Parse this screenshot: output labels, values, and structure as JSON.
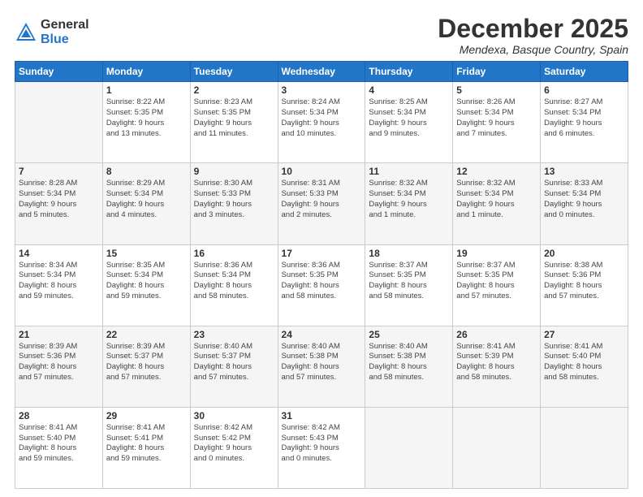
{
  "logo": {
    "general": "General",
    "blue": "Blue"
  },
  "title": "December 2025",
  "location": "Mendexa, Basque Country, Spain",
  "weekdays": [
    "Sunday",
    "Monday",
    "Tuesday",
    "Wednesday",
    "Thursday",
    "Friday",
    "Saturday"
  ],
  "weeks": [
    [
      {
        "day": "",
        "info": ""
      },
      {
        "day": "1",
        "info": "Sunrise: 8:22 AM\nSunset: 5:35 PM\nDaylight: 9 hours\nand 13 minutes."
      },
      {
        "day": "2",
        "info": "Sunrise: 8:23 AM\nSunset: 5:35 PM\nDaylight: 9 hours\nand 11 minutes."
      },
      {
        "day": "3",
        "info": "Sunrise: 8:24 AM\nSunset: 5:34 PM\nDaylight: 9 hours\nand 10 minutes."
      },
      {
        "day": "4",
        "info": "Sunrise: 8:25 AM\nSunset: 5:34 PM\nDaylight: 9 hours\nand 9 minutes."
      },
      {
        "day": "5",
        "info": "Sunrise: 8:26 AM\nSunset: 5:34 PM\nDaylight: 9 hours\nand 7 minutes."
      },
      {
        "day": "6",
        "info": "Sunrise: 8:27 AM\nSunset: 5:34 PM\nDaylight: 9 hours\nand 6 minutes."
      }
    ],
    [
      {
        "day": "7",
        "info": "Sunrise: 8:28 AM\nSunset: 5:34 PM\nDaylight: 9 hours\nand 5 minutes."
      },
      {
        "day": "8",
        "info": "Sunrise: 8:29 AM\nSunset: 5:34 PM\nDaylight: 9 hours\nand 4 minutes."
      },
      {
        "day": "9",
        "info": "Sunrise: 8:30 AM\nSunset: 5:33 PM\nDaylight: 9 hours\nand 3 minutes."
      },
      {
        "day": "10",
        "info": "Sunrise: 8:31 AM\nSunset: 5:33 PM\nDaylight: 9 hours\nand 2 minutes."
      },
      {
        "day": "11",
        "info": "Sunrise: 8:32 AM\nSunset: 5:34 PM\nDaylight: 9 hours\nand 1 minute."
      },
      {
        "day": "12",
        "info": "Sunrise: 8:32 AM\nSunset: 5:34 PM\nDaylight: 9 hours\nand 1 minute."
      },
      {
        "day": "13",
        "info": "Sunrise: 8:33 AM\nSunset: 5:34 PM\nDaylight: 9 hours\nand 0 minutes."
      }
    ],
    [
      {
        "day": "14",
        "info": "Sunrise: 8:34 AM\nSunset: 5:34 PM\nDaylight: 8 hours\nand 59 minutes."
      },
      {
        "day": "15",
        "info": "Sunrise: 8:35 AM\nSunset: 5:34 PM\nDaylight: 8 hours\nand 59 minutes."
      },
      {
        "day": "16",
        "info": "Sunrise: 8:36 AM\nSunset: 5:34 PM\nDaylight: 8 hours\nand 58 minutes."
      },
      {
        "day": "17",
        "info": "Sunrise: 8:36 AM\nSunset: 5:35 PM\nDaylight: 8 hours\nand 58 minutes."
      },
      {
        "day": "18",
        "info": "Sunrise: 8:37 AM\nSunset: 5:35 PM\nDaylight: 8 hours\nand 58 minutes."
      },
      {
        "day": "19",
        "info": "Sunrise: 8:37 AM\nSunset: 5:35 PM\nDaylight: 8 hours\nand 57 minutes."
      },
      {
        "day": "20",
        "info": "Sunrise: 8:38 AM\nSunset: 5:36 PM\nDaylight: 8 hours\nand 57 minutes."
      }
    ],
    [
      {
        "day": "21",
        "info": "Sunrise: 8:39 AM\nSunset: 5:36 PM\nDaylight: 8 hours\nand 57 minutes."
      },
      {
        "day": "22",
        "info": "Sunrise: 8:39 AM\nSunset: 5:37 PM\nDaylight: 8 hours\nand 57 minutes."
      },
      {
        "day": "23",
        "info": "Sunrise: 8:40 AM\nSunset: 5:37 PM\nDaylight: 8 hours\nand 57 minutes."
      },
      {
        "day": "24",
        "info": "Sunrise: 8:40 AM\nSunset: 5:38 PM\nDaylight: 8 hours\nand 57 minutes."
      },
      {
        "day": "25",
        "info": "Sunrise: 8:40 AM\nSunset: 5:38 PM\nDaylight: 8 hours\nand 58 minutes."
      },
      {
        "day": "26",
        "info": "Sunrise: 8:41 AM\nSunset: 5:39 PM\nDaylight: 8 hours\nand 58 minutes."
      },
      {
        "day": "27",
        "info": "Sunrise: 8:41 AM\nSunset: 5:40 PM\nDaylight: 8 hours\nand 58 minutes."
      }
    ],
    [
      {
        "day": "28",
        "info": "Sunrise: 8:41 AM\nSunset: 5:40 PM\nDaylight: 8 hours\nand 59 minutes."
      },
      {
        "day": "29",
        "info": "Sunrise: 8:41 AM\nSunset: 5:41 PM\nDaylight: 8 hours\nand 59 minutes."
      },
      {
        "day": "30",
        "info": "Sunrise: 8:42 AM\nSunset: 5:42 PM\nDaylight: 9 hours\nand 0 minutes."
      },
      {
        "day": "31",
        "info": "Sunrise: 8:42 AM\nSunset: 5:43 PM\nDaylight: 9 hours\nand 0 minutes."
      },
      {
        "day": "",
        "info": ""
      },
      {
        "day": "",
        "info": ""
      },
      {
        "day": "",
        "info": ""
      }
    ]
  ]
}
